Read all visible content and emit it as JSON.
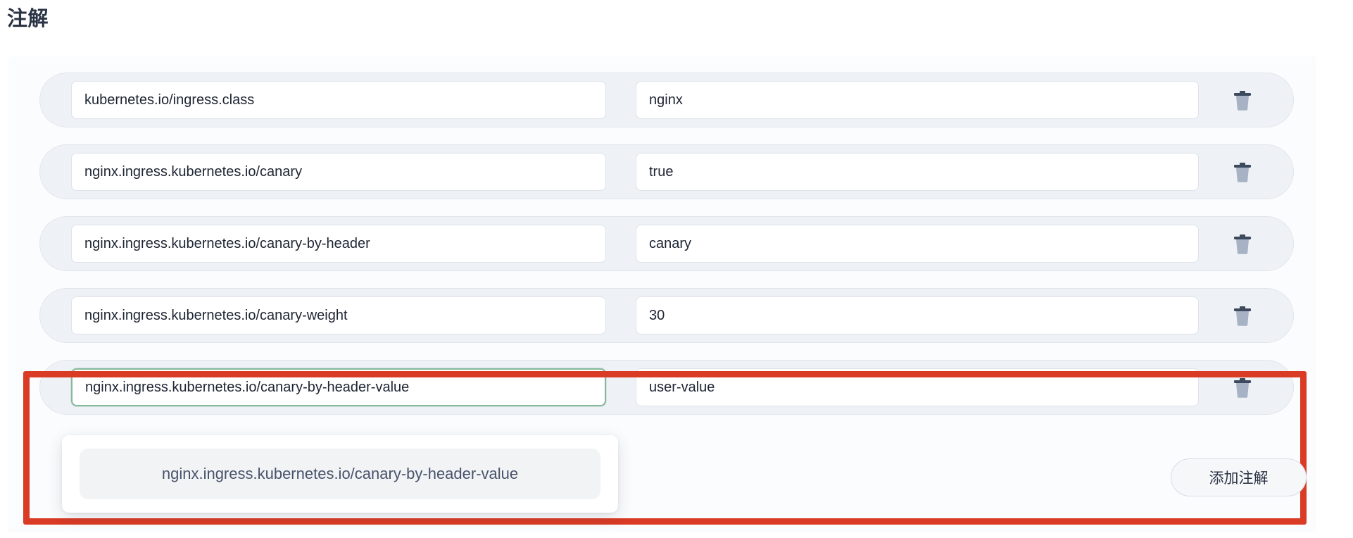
{
  "page": {
    "title": "注解"
  },
  "colors": {
    "accent_highlight": "#d93b25",
    "focus_border": "#86b89c",
    "row_background": "#eef1f5",
    "panel_background": "#fbfcfd",
    "title_text": "#2b3445",
    "trash_icon": "#9aa6bb"
  },
  "annotations": {
    "rows": [
      {
        "key": "kubernetes.io/ingress.class",
        "value": "nginx",
        "key_placeholder": "",
        "value_placeholder": "",
        "delete_icon": "trash-icon",
        "focused": false
      },
      {
        "key": "nginx.ingress.kubernetes.io/canary",
        "value": "true",
        "key_placeholder": "",
        "value_placeholder": "",
        "delete_icon": "trash-icon",
        "focused": false
      },
      {
        "key": "nginx.ingress.kubernetes.io/canary-by-header",
        "value": "canary",
        "key_placeholder": "",
        "value_placeholder": "",
        "delete_icon": "trash-icon",
        "focused": false
      },
      {
        "key": "nginx.ingress.kubernetes.io/canary-weight",
        "value": "30",
        "key_placeholder": "",
        "value_placeholder": "",
        "delete_icon": "trash-icon",
        "focused": false
      },
      {
        "key": "nginx.ingress.kubernetes.io/canary-by-header-value",
        "value": "user-value",
        "key_placeholder": "",
        "value_placeholder": "",
        "delete_icon": "trash-icon",
        "focused": true
      }
    ]
  },
  "suggestions": {
    "visible": true,
    "items": [
      {
        "label": "nginx.ingress.kubernetes.io/canary-by-header-value"
      }
    ]
  },
  "add_button": {
    "label": "添加注解"
  }
}
